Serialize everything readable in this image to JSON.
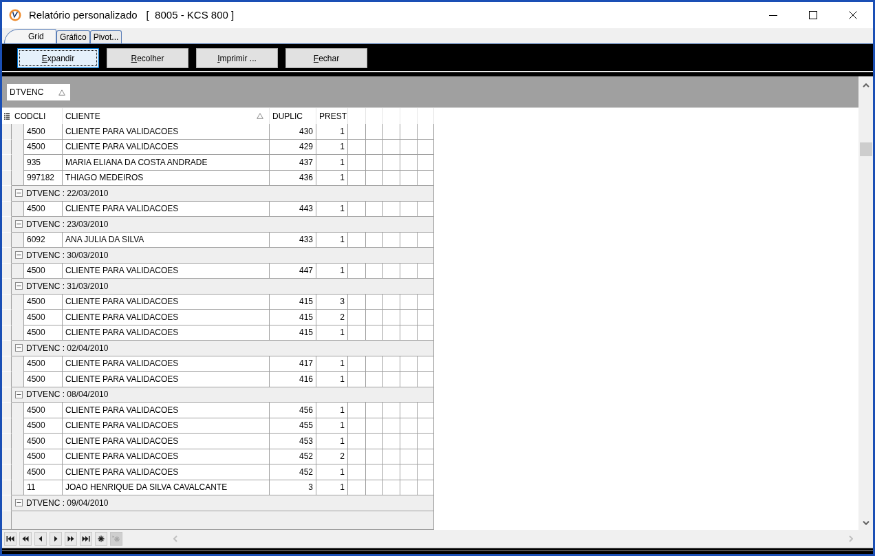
{
  "window": {
    "title": "Relatório personalizado",
    "subtitle": "[  8005 - KCS 800 ]"
  },
  "tabs": [
    {
      "label": "Grid",
      "selected": true
    },
    {
      "label": "Gráfico",
      "selected": false
    },
    {
      "label": "Pivot...",
      "selected": false
    }
  ],
  "toolbar": {
    "buttons": [
      {
        "label": "Expandir",
        "focused": true
      },
      {
        "label": "Recolher",
        "focused": false
      },
      {
        "label": "Imprimir ...",
        "focused": false
      },
      {
        "label": "Fechar",
        "focused": false
      }
    ]
  },
  "group_panel": {
    "fields": [
      {
        "label": "DTVENC",
        "sorted": true
      }
    ]
  },
  "grid": {
    "columns": [
      {
        "label": "CODCLI",
        "sorted": false
      },
      {
        "label": "CLIENTE",
        "sorted": true
      },
      {
        "label": "DUPLIC",
        "sorted": false
      },
      {
        "label": "PREST",
        "sorted": false
      }
    ],
    "leading_rows": [
      {
        "cells": [
          "4500",
          "CLIENTE PARA VALIDACOES",
          "430",
          "1"
        ]
      },
      {
        "cells": [
          "4500",
          "CLIENTE PARA VALIDACOES",
          "429",
          "1"
        ]
      },
      {
        "cells": [
          "935",
          "MARIA ELIANA DA COSTA ANDRADE",
          "437",
          "1"
        ]
      },
      {
        "cells": [
          "997182",
          "THIAGO MEDEIROS",
          "436",
          "1"
        ]
      }
    ],
    "groups": [
      {
        "label": "DTVENC : 22/03/2010",
        "expanded": true,
        "children": [
          {
            "cells": [
              "4500",
              "CLIENTE PARA VALIDACOES",
              "443",
              "1"
            ]
          }
        ]
      },
      {
        "label": "DTVENC : 23/03/2010",
        "expanded": true,
        "children": [
          {
            "cells": [
              "6092",
              "ANA JULIA DA SILVA",
              "433",
              "1"
            ]
          }
        ]
      },
      {
        "label": "DTVENC : 30/03/2010",
        "expanded": true,
        "children": [
          {
            "cells": [
              "4500",
              "CLIENTE PARA VALIDACOES",
              "447",
              "1"
            ]
          }
        ]
      },
      {
        "label": "DTVENC : 31/03/2010",
        "expanded": true,
        "children": [
          {
            "cells": [
              "4500",
              "CLIENTE PARA VALIDACOES",
              "415",
              "3"
            ]
          },
          {
            "cells": [
              "4500",
              "CLIENTE PARA VALIDACOES",
              "415",
              "2"
            ]
          },
          {
            "cells": [
              "4500",
              "CLIENTE PARA VALIDACOES",
              "415",
              "1"
            ]
          }
        ]
      },
      {
        "label": "DTVENC : 02/04/2010",
        "expanded": true,
        "children": [
          {
            "cells": [
              "4500",
              "CLIENTE PARA VALIDACOES",
              "417",
              "1"
            ]
          },
          {
            "cells": [
              "4500",
              "CLIENTE PARA VALIDACOES",
              "416",
              "1"
            ]
          }
        ]
      },
      {
        "label": "DTVENC : 08/04/2010",
        "expanded": true,
        "children": [
          {
            "cells": [
              "4500",
              "CLIENTE PARA VALIDACOES",
              "456",
              "1"
            ]
          },
          {
            "cells": [
              "4500",
              "CLIENTE PARA VALIDACOES",
              "455",
              "1"
            ]
          },
          {
            "cells": [
              "4500",
              "CLIENTE PARA VALIDACOES",
              "453",
              "1"
            ]
          },
          {
            "cells": [
              "4500",
              "CLIENTE PARA VALIDACOES",
              "452",
              "2"
            ]
          },
          {
            "cells": [
              "4500",
              "CLIENTE PARA VALIDACOES",
              "452",
              "1"
            ]
          },
          {
            "cells": [
              "11",
              "JOAO HENRIQUE DA SILVA CAVALCANTE",
              "3",
              "1"
            ]
          }
        ]
      },
      {
        "label": "DTVENC : 09/04/2010",
        "expanded": true
      }
    ]
  },
  "navigator": {
    "buttons": [
      {
        "kind": "first",
        "disabled": false
      },
      {
        "kind": "prior_page",
        "disabled": false
      },
      {
        "kind": "prior",
        "disabled": false
      },
      {
        "kind": "next",
        "disabled": false
      },
      {
        "kind": "next_page",
        "disabled": false
      },
      {
        "kind": "last",
        "disabled": false
      },
      {
        "kind": "append",
        "disabled": false
      },
      {
        "kind": "insert",
        "disabled": true
      }
    ]
  }
}
